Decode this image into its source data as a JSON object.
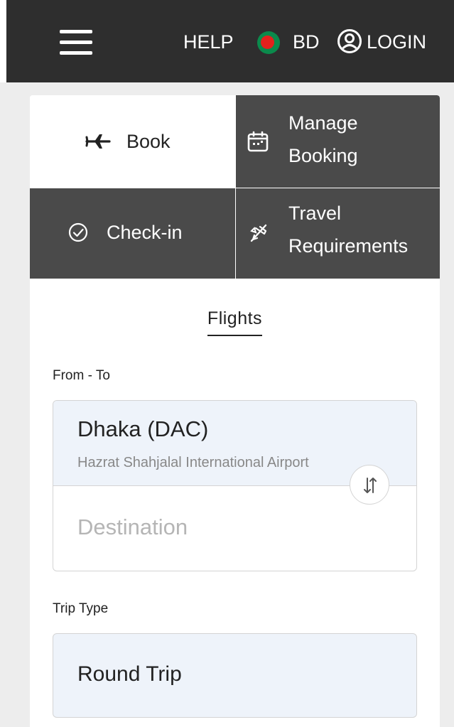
{
  "header": {
    "menu_icon": "hamburger-menu-icon",
    "help_label": "HELP",
    "country_code": "BD",
    "flag_icon": "bangladesh-flag-icon",
    "user_icon": "user-circle-icon",
    "login_label": "LOGIN"
  },
  "tabs": [
    {
      "label": "Book",
      "icon": "airplane-icon",
      "active": true
    },
    {
      "label_line1": "Manage",
      "label_line2": "Booking",
      "icon": "calendar-icon",
      "active": false
    },
    {
      "label": "Check-in",
      "icon": "check-circle-icon",
      "active": false
    },
    {
      "label_line1": "Travel",
      "label_line2": "Requirements",
      "icon": "plane-crossed-icon",
      "active": false
    }
  ],
  "section_title": "Flights",
  "from_to": {
    "label": "From - To",
    "origin_city": "Dhaka (DAC)",
    "origin_airport": "Hazrat Shahjalal International Airport",
    "destination_placeholder": "Destination",
    "swap_icon": "swap-arrows-icon"
  },
  "trip_type": {
    "label": "Trip Type",
    "value": "Round Trip"
  },
  "colors": {
    "header_bg": "#2e2e2e",
    "tab_inactive_bg": "#4a4a4a",
    "field_bg": "#eef3fa",
    "flag_green": "#0b8a4c",
    "flag_red": "#e4211d"
  }
}
